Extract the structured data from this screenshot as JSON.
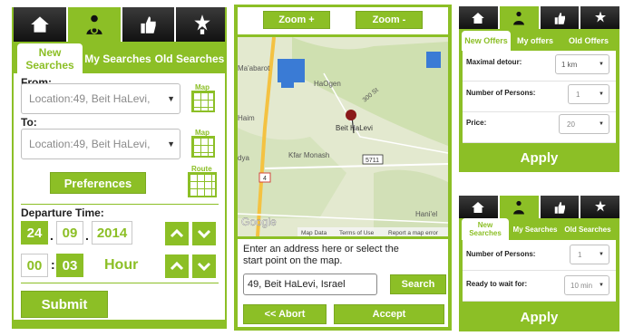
{
  "p1": {
    "subtabs": [
      "New Searches",
      "My Searches",
      "Old Searches"
    ],
    "from_label": "From:",
    "from_value": "Location:49, Beit HaLevi,",
    "map_label": "Map",
    "to_label": "To:",
    "to_value": "Location:49, Beit HaLevi,",
    "map_label2": "Map",
    "preferences": "Preferences",
    "route_label": "Route",
    "departure_label": "Departure Time:",
    "day": "24",
    "month": "09",
    "year": "2014",
    "hour": "00",
    "minute": "03",
    "unit": "Hour",
    "submit": "Submit",
    "dot1": ".",
    "dot2": ".",
    "colon": ":"
  },
  "p2": {
    "zoom_in": "Zoom +",
    "zoom_out": "Zoom -",
    "map_places": [
      "Ma'abarot",
      "HaOgen",
      "Beit HaLevi",
      "Kfar Monash",
      "Hani'el",
      "Haim",
      "dya"
    ],
    "road_numbers": [
      "5711",
      "4",
      "300 St"
    ],
    "google": "Google",
    "map_footer": [
      "Map Data",
      "Terms of Use",
      "Report a map error"
    ],
    "instructions": "Enter an address here or select the start point on the map.",
    "address_value": "49, Beit HaLevi, Israel",
    "search": "Search",
    "abort": "<< Abort",
    "accept": "Accept"
  },
  "p3": {
    "subtabs": [
      "New Offers",
      "My offers",
      "Old Offers"
    ],
    "detour_label": "Maximal detour:",
    "detour_value": "1 km",
    "persons_label": "Number of Persons:",
    "persons_value": "1",
    "price_label": "Price:",
    "price_value": "20",
    "apply": "Apply"
  },
  "p4": {
    "subtabs": [
      "New Searches",
      "My Searches",
      "Old Searches"
    ],
    "persons_label": "Number of Persons:",
    "persons_value": "1",
    "wait_label": "Ready to wait for:",
    "wait_value": "10 min",
    "apply": "Apply"
  },
  "colors": {
    "accent": "#8cbf26",
    "dark": "#1a1a1a"
  },
  "icons": [
    "home-icon",
    "driver-icon",
    "thumbs-up-icon",
    "road-icon",
    "dropdown-arrow-icon",
    "chevron-up-icon",
    "chevron-down-icon",
    "map-grid-icon",
    "map-pin-icon"
  ]
}
